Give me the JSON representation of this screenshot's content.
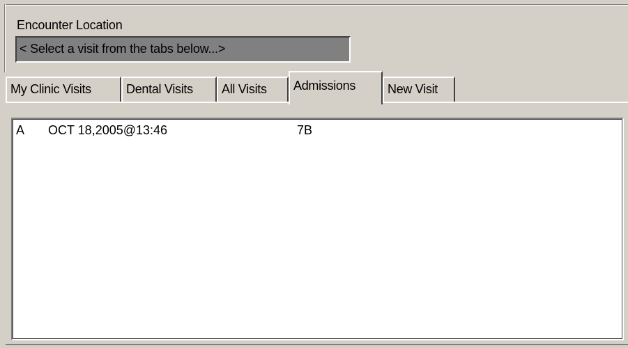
{
  "encounter": {
    "label": "Encounter Location",
    "value": "< Select a visit from the tabs below...>"
  },
  "tabs": [
    {
      "label": "My Clinic Visits",
      "active": false
    },
    {
      "label": "Dental Visits",
      "active": false
    },
    {
      "label": "All Visits",
      "active": false
    },
    {
      "label": "Admissions",
      "active": true
    },
    {
      "label": "New Visit",
      "active": false
    }
  ],
  "visits": [
    {
      "type": "A",
      "datetime": "OCT 18,2005@13:46",
      "location": "7B"
    }
  ],
  "colors": {
    "window_bg": "#d4d0c8",
    "field_bg": "#808080",
    "list_bg": "#ffffff"
  }
}
